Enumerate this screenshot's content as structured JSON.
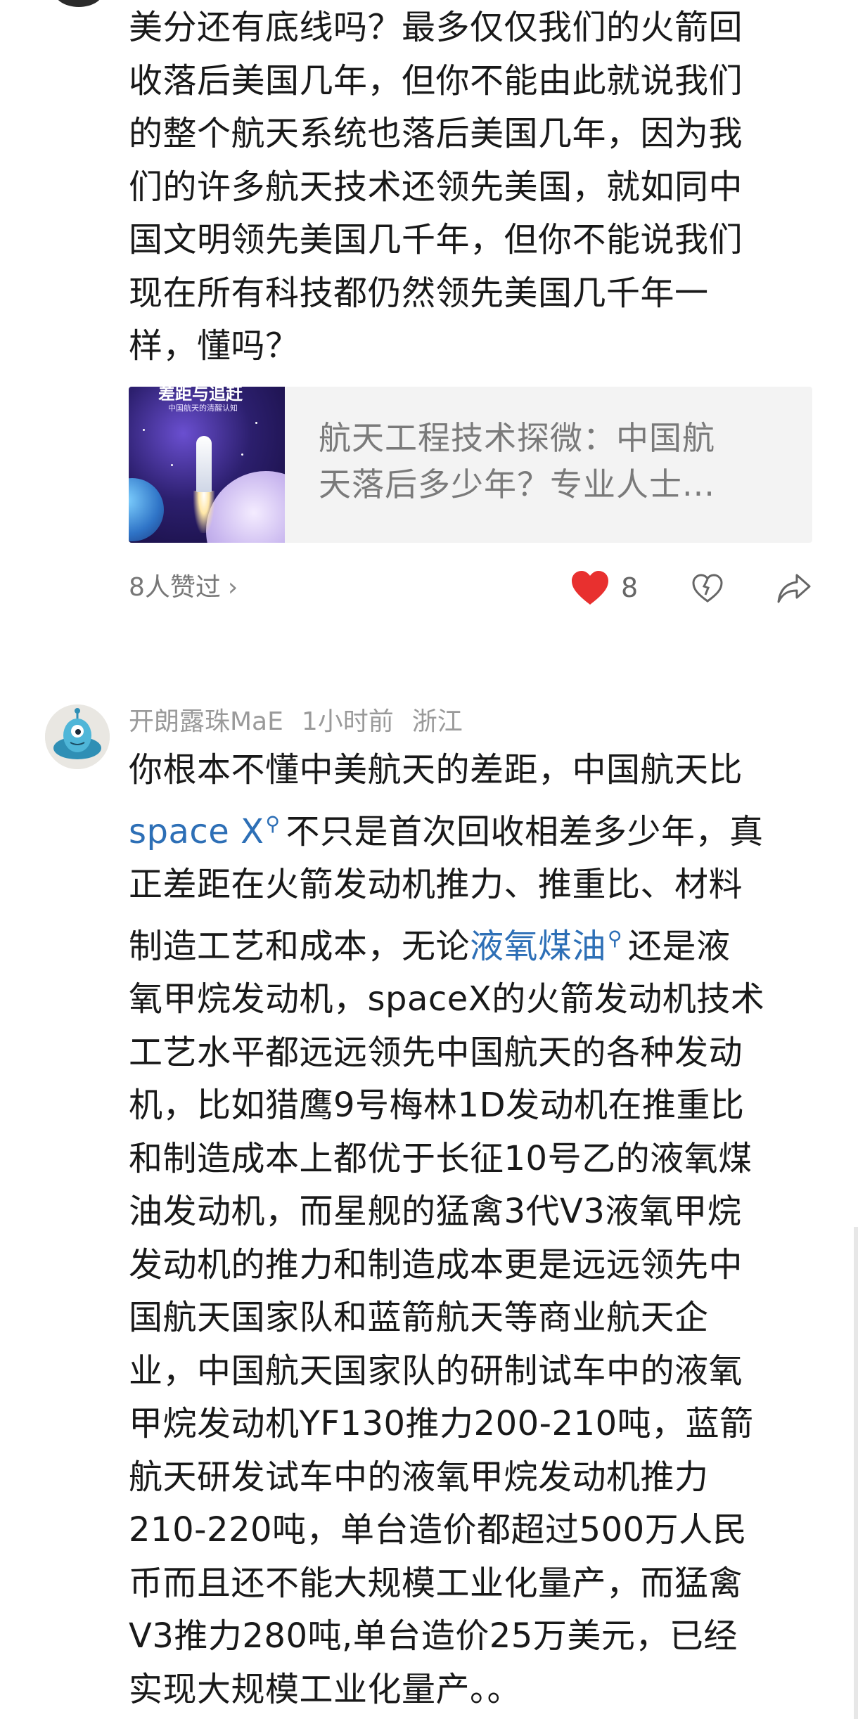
{
  "comment1": {
    "text_lines": [
      "美分还有底线吗？最多仅仅我们的火箭回",
      "收落后美国几年，但你不能由此就说我们",
      "的整个航天系统也落后美国几年，因为我",
      "们的许多航天技术还领先美国，就如同中",
      "国文明领先美国几千年，但你不能说我们",
      "现在所有科技都仍然领先美国几千年一",
      "样，懂吗？"
    ],
    "link_card": {
      "thumb_title": "差距与追赶",
      "thumb_subtitle": "中国航天的清醒认知",
      "title_lines": [
        "航天工程技术探微：中国航",
        "天落后多少年？专业人士..."
      ]
    },
    "likes_summary": "8人赞过",
    "like_count": "8",
    "accent_color": "#e8302f"
  },
  "comment2": {
    "username": "开朗露珠MaE",
    "time": "1小时前",
    "location": "浙江",
    "lines": {
      "l1": "你根本不懂中美航天的差距，中国航天比",
      "l2_link": "space X",
      "l2_rest": "不只是首次回收相差多少年，真",
      "l3": "正差距在火箭发动机推力、推重比、材料",
      "l4_pre": "制造工艺和成本，无论",
      "l4_link": "液氧煤油",
      "l4_post": "还是液",
      "l5": "氧甲烷发动机，spaceX的火箭发动机技术",
      "l6": "工艺水平都远远领先中国航天的各种发动",
      "l7": "机，比如猎鹰9号梅林1D发动机在推重比",
      "l8": "和制造成本上都优于长征10号乙的液氧煤",
      "l9": "油发动机，而星舰的猛禽3代V3液氧甲烷",
      "l10": "发动机的推力和制造成本更是远远领先中",
      "l11": "国航天国家队和蓝箭航天等商业航天企",
      "l12": "业，中国航天国家队的研制试车中的液氧",
      "l13": "甲烷发动机YF130推力200-210吨，蓝箭",
      "l14": "航天研发试车中的液氧甲烷发动机推力",
      "l15": "210-220吨，单台造价都超过500万人民",
      "l16": "币而且还不能大规模工业化量产，而猛禽",
      "l17": "V3推力280吨,单台造价25万美元，已经",
      "l18": "实现大规模工业化量产。。"
    },
    "link_color": "#2d6fb6",
    "search_icon": "search-icon"
  }
}
